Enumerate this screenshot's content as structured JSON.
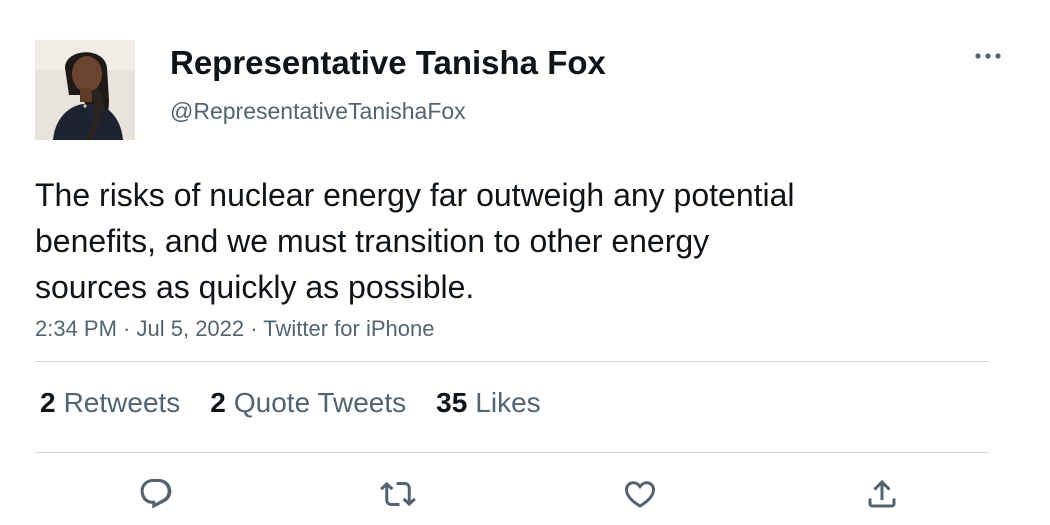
{
  "author": {
    "display_name": "Representative Tanisha Fox",
    "handle": "@RepresentativeTanishaFox",
    "avatar_icon": "profile-photo"
  },
  "tweet": {
    "text": "The risks of nuclear energy far outweigh any potential\nbenefits, and we must transition to other energy\nsources as quickly as possible.",
    "time": "2:34 PM",
    "date": "Jul 5, 2022",
    "source": "Twitter for iPhone",
    "separator": " · "
  },
  "stats": {
    "retweets": {
      "count": "2",
      "label": "Retweets"
    },
    "quote_tweets": {
      "count": "2",
      "label": "Quote Tweets"
    },
    "likes": {
      "count": "35",
      "label": "Likes"
    }
  },
  "actions": {
    "reply_icon": "reply-icon",
    "retweet_icon": "retweet-icon",
    "like_icon": "heart-icon",
    "share_icon": "share-icon"
  },
  "colors": {
    "text_primary": "#0f1419",
    "text_secondary": "#536471",
    "divider": "#cfd9de"
  }
}
